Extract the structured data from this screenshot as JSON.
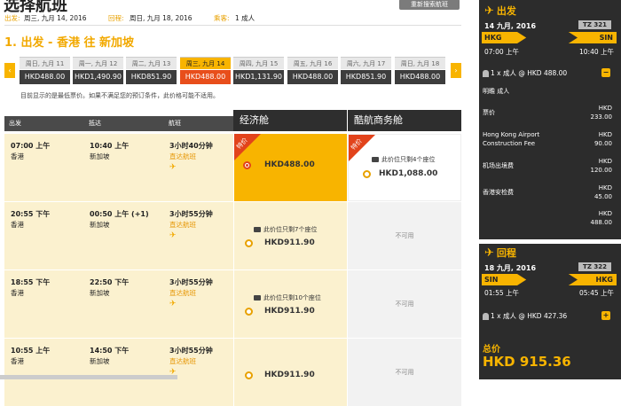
{
  "header": {
    "title": "选择航班",
    "redo_label": "重新搜索航班",
    "depart_label": "出发:",
    "depart_value": "周三, 九月 14, 2016",
    "return_label": "回程:",
    "return_value": "周日, 九月 18, 2016",
    "pax_label": "乘客:",
    "pax_value": "1 成人"
  },
  "route_heading": "1. 出发 - 香港 往 新加坡",
  "dates": [
    {
      "day": "周日, 九月 11",
      "price": "HKD488.00"
    },
    {
      "day": "周一, 九月 12",
      "price": "HKD1,490.90"
    },
    {
      "day": "周二, 九月 13",
      "price": "HKD851.90"
    },
    {
      "day": "周三, 九月 14",
      "price": "HKD488.00"
    },
    {
      "day": "周四, 九月 15",
      "price": "HKD1,131.90"
    },
    {
      "day": "周五, 九月 16",
      "price": "HKD488.00"
    },
    {
      "day": "周六, 九月 17",
      "price": "HKD851.90"
    },
    {
      "day": "周日, 九月 18",
      "price": "HKD488.00"
    }
  ],
  "note": "目前显示的是最低票价。如果不满足您的预订条件，此价格可能不适用。",
  "columns": {
    "depart": "出发",
    "arrive": "抵达",
    "flight": "航班",
    "economy": "经济舱",
    "business": "酷航商务舱"
  },
  "ribbon": "特价",
  "flights": [
    {
      "dep_time": "07:00 上午",
      "dep_city": "香港",
      "arr_time": "10:40 上午",
      "arr_city": "新加坡",
      "duration": "3小时40分钟",
      "type": "直达航班",
      "eco_note": "",
      "eco_price": "HKD488.00",
      "biz_note": "此价位只剩4个座位",
      "biz_price": "HKD1,088.00",
      "biz_na": ""
    },
    {
      "dep_time": "20:55 下午",
      "dep_city": "香港",
      "arr_time": "00:50 上午 (+1)",
      "arr_city": "新加坡",
      "duration": "3小时55分钟",
      "type": "直达航班",
      "eco_note": "此价位只剩7个座位",
      "eco_price": "HKD911.90",
      "biz_note": "",
      "biz_price": "",
      "biz_na": "不可用"
    },
    {
      "dep_time": "18:55 下午",
      "dep_city": "香港",
      "arr_time": "22:50 下午",
      "arr_city": "新加坡",
      "duration": "3小时55分钟",
      "type": "直达航班",
      "eco_note": "此价位只剩10个座位",
      "eco_price": "HKD911.90",
      "biz_note": "",
      "biz_price": "",
      "biz_na": "不可用"
    },
    {
      "dep_time": "10:55 上午",
      "dep_city": "香港",
      "arr_time": "14:50 下午",
      "arr_city": "新加坡",
      "duration": "3小时55分钟",
      "type": "直达航班",
      "eco_note": "",
      "eco_price": "HKD911.90",
      "biz_note": "",
      "biz_price": "",
      "biz_na": "不可用"
    }
  ],
  "summary": {
    "outbound": {
      "label": "出发",
      "date": "14 九月, 2016",
      "flight_no": "TZ 321",
      "from": "HKG",
      "to": "SIN",
      "dep": "07:00 上午",
      "arr": "10:40 上午",
      "pax_line": "1 x 成人 @ HKD 488.00",
      "toggle": "−",
      "passenger": "明瞻 成人",
      "breakdown": [
        {
          "label": "票价",
          "amount": "HKD\n233.00"
        },
        {
          "label": "Hong Kong Airport\nConstruction Fee",
          "amount": "HKD\n90.00"
        },
        {
          "label": "机场出境费",
          "amount": "HKD\n120.00"
        },
        {
          "label": "香港安检费",
          "amount": "HKD\n45.00"
        },
        {
          "label": "",
          "amount": "HKD\n488.00"
        }
      ]
    },
    "return": {
      "label": "回程",
      "date": "18 九月, 2016",
      "flight_no": "TZ 322",
      "from": "SIN",
      "to": "HKG",
      "dep": "01:55 上午",
      "arr": "05:45 上午",
      "pax_line": "1 x 成人 @ HKD 427.36",
      "toggle": "+"
    },
    "total_label": "总价",
    "total_value": "HKD 915.36"
  }
}
